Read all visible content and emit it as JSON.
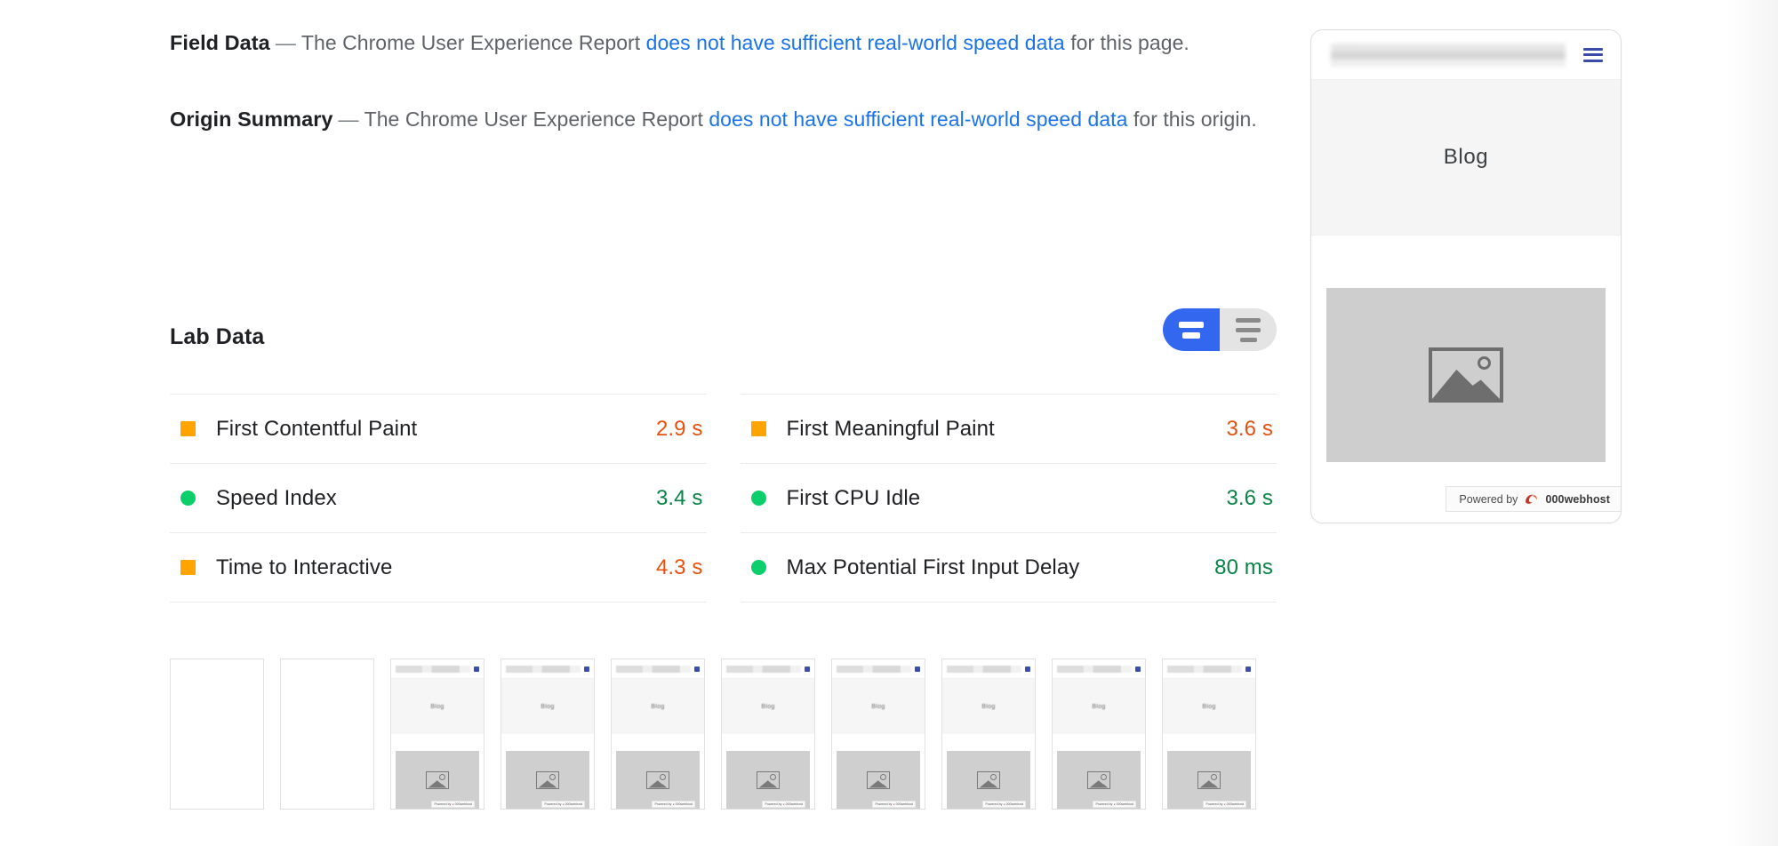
{
  "field_data": {
    "heading": "Field Data",
    "dash": "—",
    "text_before": "The Chrome User Experience Report ",
    "link": "does not have sufficient real-world speed data",
    "text_after": " for this page."
  },
  "origin_summary": {
    "heading": "Origin Summary",
    "dash": "—",
    "text_before": "The Chrome User Experience Report ",
    "link": "does not have sufficient real-world speed data",
    "text_after": " for this origin."
  },
  "lab_data": {
    "title": "Lab Data",
    "view_toggle": {
      "compact_label": "compact-view",
      "expanded_label": "expanded-view",
      "active": "compact-view",
      "active_color": "#3367f0",
      "inactive_color": "#e4e4e4"
    },
    "marker_colors": {
      "average": "#ffa400",
      "fast": "#0cce6b"
    },
    "value_colors": {
      "average": "#e8500f",
      "fast": "#078345"
    },
    "left_column": [
      {
        "label": "First Contentful Paint",
        "value": "2.9 s",
        "status": "average"
      },
      {
        "label": "Speed Index",
        "value": "3.4 s",
        "status": "fast"
      },
      {
        "label": "Time to Interactive",
        "value": "4.3 s",
        "status": "average"
      }
    ],
    "right_column": [
      {
        "label": "First Meaningful Paint",
        "value": "3.6 s",
        "status": "average"
      },
      {
        "label": "First CPU Idle",
        "value": "3.6 s",
        "status": "fast"
      },
      {
        "label": "Max Potential First Input Delay",
        "value": "80 ms",
        "status": "fast"
      }
    ]
  },
  "filmstrip": {
    "frames": [
      {
        "rendered": false
      },
      {
        "rendered": false
      },
      {
        "rendered": true
      },
      {
        "rendered": true
      },
      {
        "rendered": true
      },
      {
        "rendered": true
      },
      {
        "rendered": true
      },
      {
        "rendered": true
      },
      {
        "rendered": true
      },
      {
        "rendered": true
      }
    ],
    "frame_hero_text": "Blog",
    "frame_badge_prefix": "Powered by",
    "frame_badge_brand": "000webhost"
  },
  "phone_preview": {
    "hero_text": "Blog",
    "badge_prefix": "Powered by",
    "badge_brand": "000webhost",
    "menu_icon": "hamburger-icon",
    "image_icon": "image-placeholder-icon"
  }
}
